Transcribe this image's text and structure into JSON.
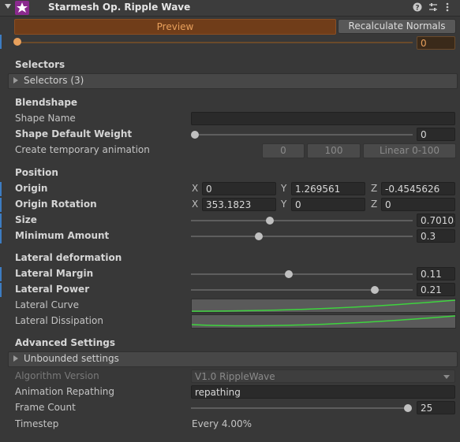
{
  "header": {
    "title": "Starmesh Op. Ripple Wave",
    "help_icon": "question-icon",
    "settings_icon": "sliders-icon",
    "menu_icon": "kebab-icon"
  },
  "toolbar": {
    "preview_label": "Preview",
    "recalc_label": "Recalculate Normals",
    "timeline_value": "0",
    "accent_color": "#e8a05c"
  },
  "selectors": {
    "section": "Selectors",
    "foldout_label": "Selectors (3)"
  },
  "blendshape": {
    "section": "Blendshape",
    "shape_name_label": "Shape Name",
    "shape_name_value": "",
    "weight_label": "Shape Default Weight",
    "weight_value": "0",
    "weight_level": 0,
    "temp_anim_label": "Create temporary animation",
    "temp_btn_0": "0",
    "temp_btn_100": "100",
    "temp_btn_linear": "Linear 0-100"
  },
  "position": {
    "section": "Position",
    "origin_label": "Origin",
    "origin_x": "0",
    "origin_y": "1.269561",
    "origin_z": "-0.4545626",
    "rotation_label": "Origin Rotation",
    "rotation_x": "353.1823",
    "rotation_y": "0",
    "rotation_z": "0",
    "axis_x": "X",
    "axis_y": "Y",
    "axis_z": "Z",
    "size_label": "Size",
    "size_value": "0.70108",
    "size_level": 0.35,
    "min_label": "Minimum Amount",
    "min_value": "0.3",
    "min_level": 0.3
  },
  "lateral": {
    "section": "Lateral deformation",
    "margin_label": "Lateral Margin",
    "margin_value": "0.11",
    "margin_level": 0.44,
    "power_label": "Lateral Power",
    "power_value": "0.21",
    "power_level": 0.82,
    "curve_label": "Lateral Curve",
    "dissipation_label": "Lateral Dissipation",
    "curve_color": "#3ed43e"
  },
  "advanced": {
    "section": "Advanced Settings",
    "unbounded_label": "Unbounded settings",
    "algorithm_label": "Algorithm Version",
    "algorithm_value": "V1.0 RippleWave",
    "repathing_label": "Animation Repathing",
    "repathing_value": "repathing",
    "frame_label": "Frame Count",
    "frame_value": "25",
    "frame_level": 0.98,
    "timestep_label": "Timestep",
    "timestep_value": "Every 4.00%"
  }
}
